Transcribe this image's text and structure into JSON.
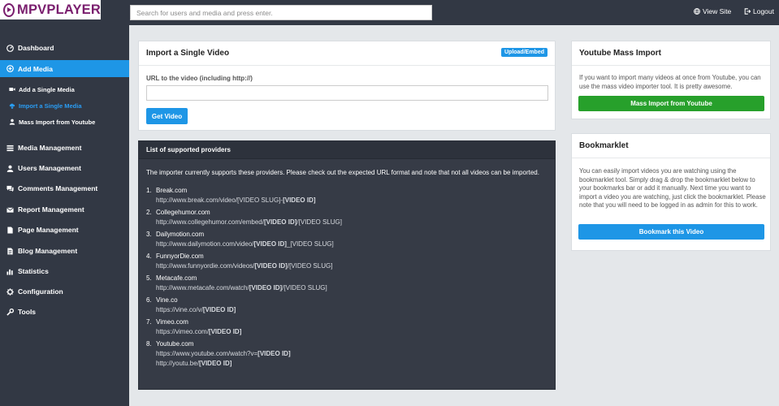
{
  "header": {
    "logo_text": "MPVPLAYER",
    "search_placeholder": "Search for users and media and press enter.",
    "view_site": "View Site",
    "logout": "Logout"
  },
  "sidebar": {
    "dashboard": "Dashboard",
    "add_media": "Add Media",
    "sub_add_single": "Add a Single Media",
    "sub_import_single": "Import a Single Media",
    "sub_mass_import": "Mass Import from Youtube",
    "media_management": "Media Management",
    "users_management": "Users Management",
    "comments_management": "Comments Management",
    "report_management": "Report Management",
    "page_management": "Page Management",
    "blog_management": "Blog Management",
    "statistics": "Statistics",
    "configuration": "Configuration",
    "tools": "Tools"
  },
  "import_panel": {
    "title": "Import a Single Video",
    "badge": "Upload/Embed",
    "url_label": "URL to the video (including http://)",
    "url_value": "",
    "button": "Get Video"
  },
  "providers_panel": {
    "title": "List of supported providers",
    "intro": "The importer currently supports these providers. Please check out the expected URL format and note that not all videos can be imported.",
    "items": [
      {
        "num": "1.",
        "name": "Break.com",
        "url_plain": "http://www.break.com/video/[VIDEO SLUG]-",
        "url_bold": "[VIDEO ID]",
        "url_tail": ""
      },
      {
        "num": "2.",
        "name": "Collegehumor.com",
        "url_plain": "http://www.collegehumor.com/embed/",
        "url_bold": "[VIDEO ID]",
        "url_tail": "/[VIDEO SLUG]"
      },
      {
        "num": "3.",
        "name": "Dailymotion.com",
        "url_plain": "http://www.dailymotion.com/video/",
        "url_bold": "[VIDEO ID]",
        "url_tail": "_[VIDEO SLUG]"
      },
      {
        "num": "4.",
        "name": "FunnyorDie.com",
        "url_plain": "http://www.funnyordie.com/videos/",
        "url_bold": "[VIDEO ID]",
        "url_tail": "/[VIDEO SLUG]"
      },
      {
        "num": "5.",
        "name": "Metacafe.com",
        "url_plain": "http://www.metacafe.com/watch/",
        "url_bold": "[VIDEO ID]",
        "url_tail": "/[VIDEO SLUG]"
      },
      {
        "num": "6.",
        "name": "Vine.co",
        "url_plain": "https://vine.co/v/",
        "url_bold": "[VIDEO ID]",
        "url_tail": ""
      },
      {
        "num": "7.",
        "name": "Vimeo.com",
        "url_plain": "https://vimeo.com/",
        "url_bold": "[VIDEO ID]",
        "url_tail": ""
      },
      {
        "num": "8.",
        "name": "Youtube.com",
        "url_plain": "https://www.youtube.com/watch?v=",
        "url_bold": "[VIDEO ID]",
        "url_tail": "",
        "url2_plain": "http://youtu.be/",
        "url2_bold": "[VIDEO ID]"
      }
    ]
  },
  "mass_import_panel": {
    "title": "Youtube Mass Import",
    "text": "If you want to import many videos at once from Youtube, you can use the mass video importer tool. It is pretty awesome.",
    "button": "Mass Import from Youtube"
  },
  "bookmarklet_panel": {
    "title": "Bookmarklet",
    "text": "You can easily import videos you are watching using the bookmarklet tool. Simply drag & drop the bookmarklet below to your bookmarks bar or add it manually. Next time you want to import a video you are watching, just click the bookmarklet. Please note that you will need to be logged in as admin for this to work.",
    "button": "Bookmark this Video"
  },
  "colors": {
    "topbar": "#323844",
    "accent": "#1e96e6",
    "green": "#27a02b",
    "brand": "#7a1e6e"
  }
}
